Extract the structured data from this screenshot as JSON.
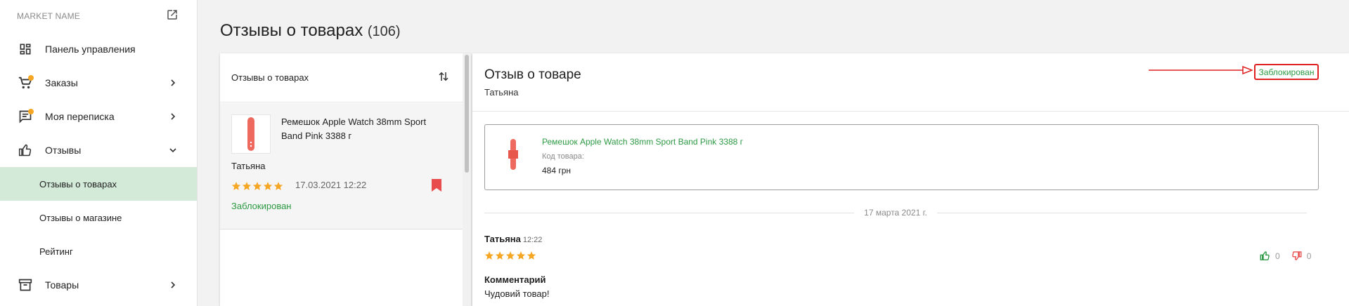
{
  "sidebar": {
    "market_name": "MARKET NAME",
    "items": [
      {
        "label": "Панель управления",
        "icon": "dashboard-icon"
      },
      {
        "label": "Заказы",
        "icon": "cart-icon",
        "badge": true
      },
      {
        "label": "Моя переписка",
        "icon": "chat-icon",
        "badge": true
      },
      {
        "label": "Отзывы",
        "icon": "thumb-up-icon",
        "expanded": true
      },
      {
        "label": "Товары",
        "icon": "box-icon"
      }
    ],
    "sub_items": [
      {
        "label": "Отзывы о товарах",
        "active": true
      },
      {
        "label": "Отзывы о магазине"
      },
      {
        "label": "Рейтинг"
      }
    ]
  },
  "page": {
    "title": "Отзывы о товарах",
    "count": "(106)"
  },
  "list": {
    "header": "Отзывы о товарах",
    "cards": [
      {
        "product": "Ремешок Apple Watch 38mm Sport Band Pink 3388 г",
        "author": "Татьяна",
        "rating": 5,
        "date": "17.03.2021 12:22",
        "status": "Заблокирован"
      }
    ]
  },
  "detail": {
    "title": "Отзыв о товаре",
    "author": "Татьяна",
    "status": "Заблокирован",
    "product": {
      "name": "Ремешок Apple Watch 38mm Sport Band Pink 3388 г",
      "code_label": "Код товара:",
      "price": "484 грн"
    },
    "date_separator": "17 марта 2021 г.",
    "message": {
      "author": "Татьяна",
      "time": "12:22",
      "rating": 5,
      "likes": "0",
      "dislikes": "0",
      "comment_label": "Комментарий",
      "comment": "Чудовий товар!"
    }
  },
  "colors": {
    "accent_green": "#2e9a44",
    "active_bg": "#d3ead9",
    "star": "#f5a623",
    "bookmark": "#e84c4c",
    "highlight_red": "#e02020"
  }
}
